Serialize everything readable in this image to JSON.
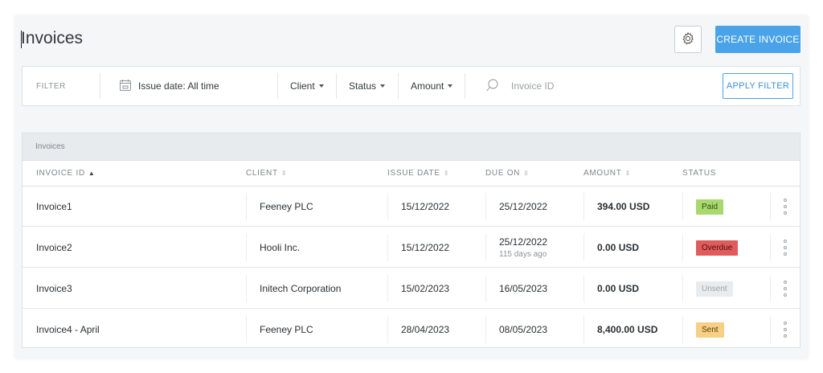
{
  "page": {
    "title": "Invoices"
  },
  "toolbar": {
    "create_label": "CREATE INVOICE",
    "settings_icon": "gear-icon"
  },
  "filter": {
    "label": "FILTER",
    "issue_date": "Issue date: All time",
    "client": "Client",
    "status": "Status",
    "amount": "Amount",
    "search_placeholder": "Invoice ID",
    "search_value": "",
    "apply_label": "APPLY FILTER"
  },
  "table": {
    "caption": "Invoices",
    "columns": [
      {
        "label": "INVOICE ID",
        "sort": "▲"
      },
      {
        "label": "CLIENT",
        "sort": "⇳"
      },
      {
        "label": "ISSUE DATE",
        "sort": "⇳"
      },
      {
        "label": "DUE ON",
        "sort": "⇳"
      },
      {
        "label": "AMOUNT",
        "sort": "⇳"
      },
      {
        "label": "STATUS",
        "sort": ""
      }
    ],
    "rows": [
      {
        "id": "Invoice1",
        "client": "Feeney PLC",
        "issue": "15/12/2022",
        "due": "25/12/2022",
        "due_note": "",
        "amount": "394.00 USD",
        "status": "Paid"
      },
      {
        "id": "Invoice2",
        "client": "Hooli Inc.",
        "issue": "15/12/2022",
        "due": "25/12/2022",
        "due_note": "115 days ago",
        "amount": "0.00 USD",
        "status": "Overdue"
      },
      {
        "id": "Invoice3",
        "client": "Initech Corporation",
        "issue": "15/02/2023",
        "due": "16/05/2023",
        "due_note": "",
        "amount": "0.00 USD",
        "status": "Unsent"
      },
      {
        "id": "Invoice4 - April",
        "client": "Feeney PLC",
        "issue": "28/04/2023",
        "due": "08/05/2023",
        "due_note": "",
        "amount": "8,400.00 USD",
        "status": "Sent"
      }
    ]
  },
  "colors": {
    "accent": "#4aa3e9",
    "paid_bg": "#a9d86e",
    "paid_fg": "#2f4d10",
    "overdue_bg": "#e05c5c",
    "overdue_fg": "#4a0d0d",
    "unsent_bg": "#e9ecef",
    "unsent_fg": "#9aa0a6",
    "sent_bg": "#f7cf86",
    "sent_fg": "#5a3d06"
  }
}
